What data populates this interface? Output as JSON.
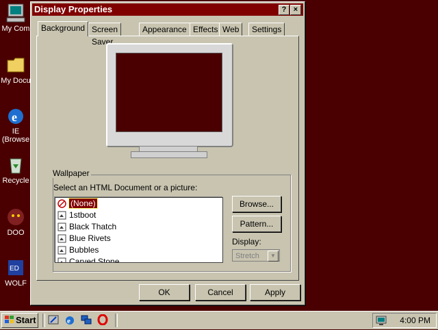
{
  "colors": {
    "desktop": "#4a0000",
    "titlebar": "#800000",
    "face": "#c8c4b0"
  },
  "desktop": {
    "icons": [
      {
        "label": "My Com",
        "icon": "my-computer-icon"
      },
      {
        "label": "My Docu",
        "icon": "folder-icon"
      },
      {
        "label": "IE",
        "label2": "(Browse",
        "icon": "internet-explorer-icon"
      },
      {
        "label": "Recycle",
        "icon": "recycle-bin-icon"
      },
      {
        "label": "DOO",
        "icon": "doom-icon"
      },
      {
        "label": "WOLF",
        "icon": "wolfenstein-icon"
      }
    ]
  },
  "window": {
    "title": "Display Properties",
    "help_btn": "?",
    "close_btn": "×",
    "tabs": [
      "Background",
      "Screen Saver",
      "Appearance",
      "Effects",
      "Web",
      "Settings"
    ],
    "active_tab": "Background",
    "wallpaper": {
      "group_label": "Wallpaper",
      "prompt": "Select an HTML Document or a picture:",
      "items": [
        "(None)",
        "1stboot",
        "Black Thatch",
        "Blue Rivets",
        "Bubbles",
        "Carved Stone"
      ],
      "selected": "(None)",
      "browse_label": "Browse...",
      "pattern_label": "Pattern...",
      "display_label": "Display:",
      "display_value": "Stretch"
    },
    "buttons": {
      "ok": "OK",
      "cancel": "Cancel",
      "apply": "Apply"
    }
  },
  "taskbar": {
    "start_label": "Start",
    "quick_launch": [
      "show-desktop-icon",
      "internet-explorer-icon",
      "network-icon",
      "opera-icon"
    ],
    "clock": "4:00 PM"
  }
}
